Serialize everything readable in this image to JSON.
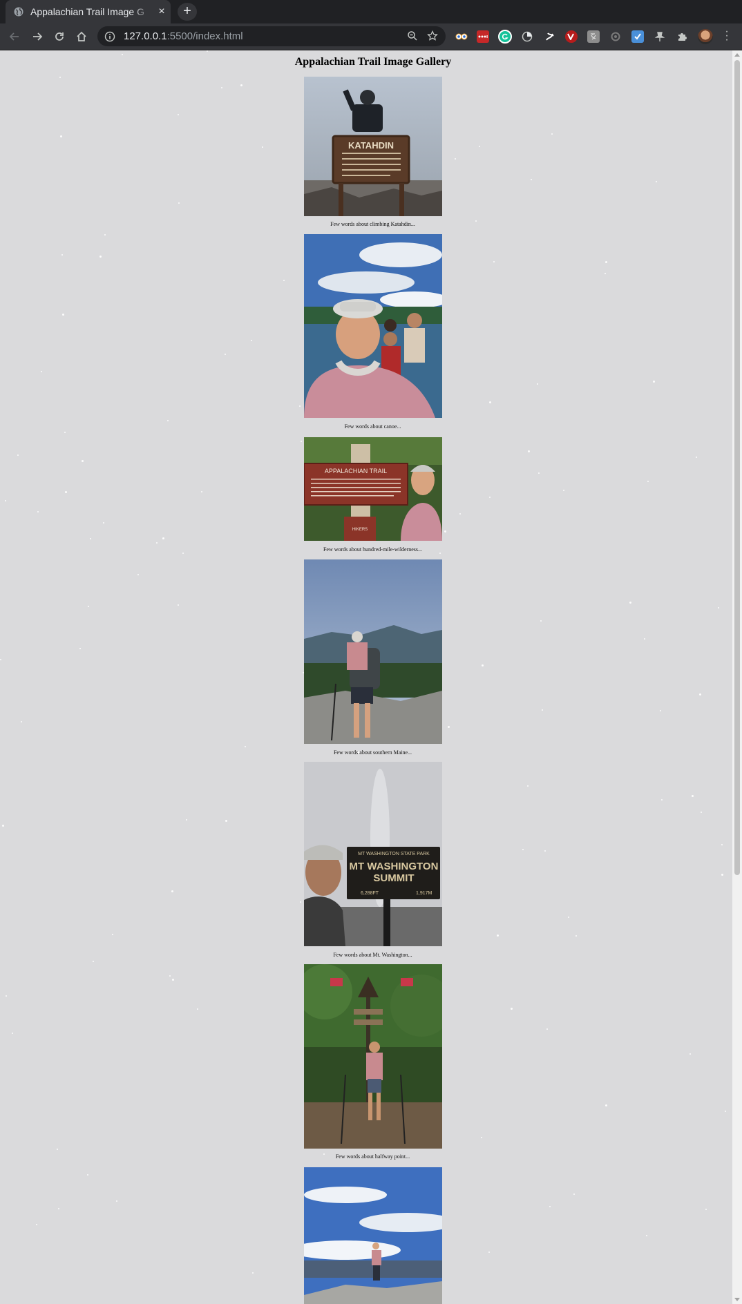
{
  "browser": {
    "tab_title": "Appalachian Trail Image G",
    "tab_close": "×",
    "new_tab": "+",
    "url_host": "127.0.0.1",
    "url_rest": ":5500/index.html"
  },
  "page": {
    "title": "Appalachian Trail Image Gallery",
    "gallery": [
      {
        "caption": "Few words about climbing Katahdin..."
      },
      {
        "caption": "Few words about canoe..."
      },
      {
        "caption": "Few words about hundred-mile-wilderness..."
      },
      {
        "caption": "Few words about southern Maine..."
      },
      {
        "caption": "Few words about Mt. Washington..."
      },
      {
        "caption": "Few words about halfway point..."
      }
    ]
  },
  "photos": {
    "katahdin_sign": "KATAHDIN",
    "at_sign": "APPALACHIAN TRAIL",
    "hikers_label": "HIKERS",
    "washington_park": "MT WASHINGTON STATE PARK",
    "washington_summit_1": "MT WASHINGTON",
    "washington_summit_2": "SUMMIT",
    "washington_ft": "6,288FT",
    "washington_m": "1,917M"
  },
  "colors": {
    "page_bg": "#dadadc",
    "chrome_dark": "#202124",
    "chrome_toolbar": "#35363a"
  }
}
